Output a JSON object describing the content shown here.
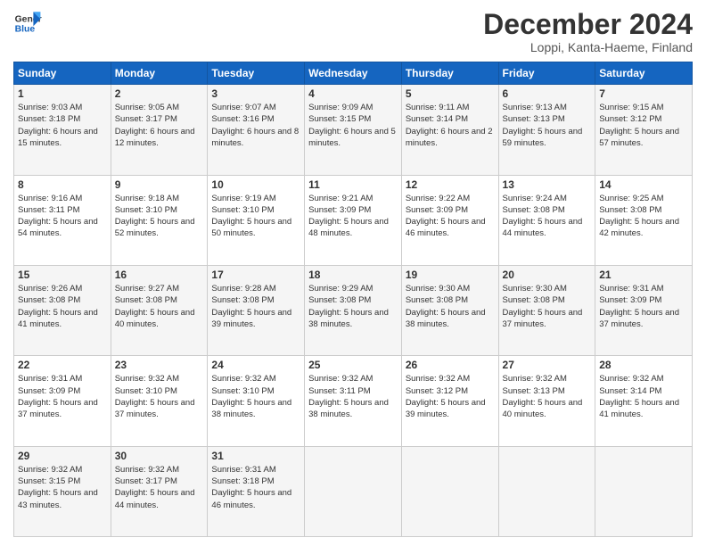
{
  "header": {
    "logo_general": "General",
    "logo_blue": "Blue",
    "month_title": "December 2024",
    "subtitle": "Loppi, Kanta-Haeme, Finland"
  },
  "days_of_week": [
    "Sunday",
    "Monday",
    "Tuesday",
    "Wednesday",
    "Thursday",
    "Friday",
    "Saturday"
  ],
  "weeks": [
    [
      {
        "day": "1",
        "sunrise": "Sunrise: 9:03 AM",
        "sunset": "Sunset: 3:18 PM",
        "daylight": "Daylight: 6 hours and 15 minutes."
      },
      {
        "day": "2",
        "sunrise": "Sunrise: 9:05 AM",
        "sunset": "Sunset: 3:17 PM",
        "daylight": "Daylight: 6 hours and 12 minutes."
      },
      {
        "day": "3",
        "sunrise": "Sunrise: 9:07 AM",
        "sunset": "Sunset: 3:16 PM",
        "daylight": "Daylight: 6 hours and 8 minutes."
      },
      {
        "day": "4",
        "sunrise": "Sunrise: 9:09 AM",
        "sunset": "Sunset: 3:15 PM",
        "daylight": "Daylight: 6 hours and 5 minutes."
      },
      {
        "day": "5",
        "sunrise": "Sunrise: 9:11 AM",
        "sunset": "Sunset: 3:14 PM",
        "daylight": "Daylight: 6 hours and 2 minutes."
      },
      {
        "day": "6",
        "sunrise": "Sunrise: 9:13 AM",
        "sunset": "Sunset: 3:13 PM",
        "daylight": "Daylight: 5 hours and 59 minutes."
      },
      {
        "day": "7",
        "sunrise": "Sunrise: 9:15 AM",
        "sunset": "Sunset: 3:12 PM",
        "daylight": "Daylight: 5 hours and 57 minutes."
      }
    ],
    [
      {
        "day": "8",
        "sunrise": "Sunrise: 9:16 AM",
        "sunset": "Sunset: 3:11 PM",
        "daylight": "Daylight: 5 hours and 54 minutes."
      },
      {
        "day": "9",
        "sunrise": "Sunrise: 9:18 AM",
        "sunset": "Sunset: 3:10 PM",
        "daylight": "Daylight: 5 hours and 52 minutes."
      },
      {
        "day": "10",
        "sunrise": "Sunrise: 9:19 AM",
        "sunset": "Sunset: 3:10 PM",
        "daylight": "Daylight: 5 hours and 50 minutes."
      },
      {
        "day": "11",
        "sunrise": "Sunrise: 9:21 AM",
        "sunset": "Sunset: 3:09 PM",
        "daylight": "Daylight: 5 hours and 48 minutes."
      },
      {
        "day": "12",
        "sunrise": "Sunrise: 9:22 AM",
        "sunset": "Sunset: 3:09 PM",
        "daylight": "Daylight: 5 hours and 46 minutes."
      },
      {
        "day": "13",
        "sunrise": "Sunrise: 9:24 AM",
        "sunset": "Sunset: 3:08 PM",
        "daylight": "Daylight: 5 hours and 44 minutes."
      },
      {
        "day": "14",
        "sunrise": "Sunrise: 9:25 AM",
        "sunset": "Sunset: 3:08 PM",
        "daylight": "Daylight: 5 hours and 42 minutes."
      }
    ],
    [
      {
        "day": "15",
        "sunrise": "Sunrise: 9:26 AM",
        "sunset": "Sunset: 3:08 PM",
        "daylight": "Daylight: 5 hours and 41 minutes."
      },
      {
        "day": "16",
        "sunrise": "Sunrise: 9:27 AM",
        "sunset": "Sunset: 3:08 PM",
        "daylight": "Daylight: 5 hours and 40 minutes."
      },
      {
        "day": "17",
        "sunrise": "Sunrise: 9:28 AM",
        "sunset": "Sunset: 3:08 PM",
        "daylight": "Daylight: 5 hours and 39 minutes."
      },
      {
        "day": "18",
        "sunrise": "Sunrise: 9:29 AM",
        "sunset": "Sunset: 3:08 PM",
        "daylight": "Daylight: 5 hours and 38 minutes."
      },
      {
        "day": "19",
        "sunrise": "Sunrise: 9:30 AM",
        "sunset": "Sunset: 3:08 PM",
        "daylight": "Daylight: 5 hours and 38 minutes."
      },
      {
        "day": "20",
        "sunrise": "Sunrise: 9:30 AM",
        "sunset": "Sunset: 3:08 PM",
        "daylight": "Daylight: 5 hours and 37 minutes."
      },
      {
        "day": "21",
        "sunrise": "Sunrise: 9:31 AM",
        "sunset": "Sunset: 3:09 PM",
        "daylight": "Daylight: 5 hours and 37 minutes."
      }
    ],
    [
      {
        "day": "22",
        "sunrise": "Sunrise: 9:31 AM",
        "sunset": "Sunset: 3:09 PM",
        "daylight": "Daylight: 5 hours and 37 minutes."
      },
      {
        "day": "23",
        "sunrise": "Sunrise: 9:32 AM",
        "sunset": "Sunset: 3:10 PM",
        "daylight": "Daylight: 5 hours and 37 minutes."
      },
      {
        "day": "24",
        "sunrise": "Sunrise: 9:32 AM",
        "sunset": "Sunset: 3:10 PM",
        "daylight": "Daylight: 5 hours and 38 minutes."
      },
      {
        "day": "25",
        "sunrise": "Sunrise: 9:32 AM",
        "sunset": "Sunset: 3:11 PM",
        "daylight": "Daylight: 5 hours and 38 minutes."
      },
      {
        "day": "26",
        "sunrise": "Sunrise: 9:32 AM",
        "sunset": "Sunset: 3:12 PM",
        "daylight": "Daylight: 5 hours and 39 minutes."
      },
      {
        "day": "27",
        "sunrise": "Sunrise: 9:32 AM",
        "sunset": "Sunset: 3:13 PM",
        "daylight": "Daylight: 5 hours and 40 minutes."
      },
      {
        "day": "28",
        "sunrise": "Sunrise: 9:32 AM",
        "sunset": "Sunset: 3:14 PM",
        "daylight": "Daylight: 5 hours and 41 minutes."
      }
    ],
    [
      {
        "day": "29",
        "sunrise": "Sunrise: 9:32 AM",
        "sunset": "Sunset: 3:15 PM",
        "daylight": "Daylight: 5 hours and 43 minutes."
      },
      {
        "day": "30",
        "sunrise": "Sunrise: 9:32 AM",
        "sunset": "Sunset: 3:17 PM",
        "daylight": "Daylight: 5 hours and 44 minutes."
      },
      {
        "day": "31",
        "sunrise": "Sunrise: 9:31 AM",
        "sunset": "Sunset: 3:18 PM",
        "daylight": "Daylight: 5 hours and 46 minutes."
      },
      null,
      null,
      null,
      null
    ]
  ]
}
